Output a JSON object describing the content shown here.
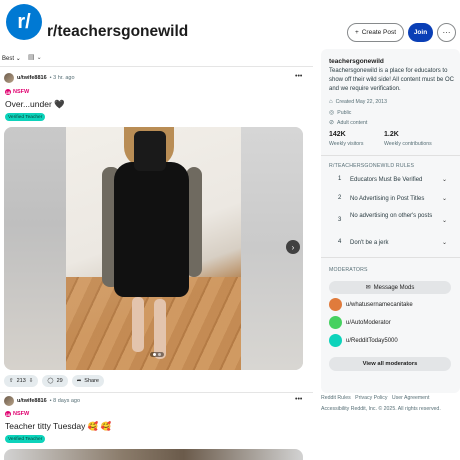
{
  "header": {
    "logo_text": "r/",
    "title": "r/teachersgonewild",
    "create_post_label": "Create Post",
    "join_label": "Join",
    "more_label": "···"
  },
  "sortbar": {
    "sort_label": "Best",
    "view_icon": "card-view-icon"
  },
  "posts": [
    {
      "user": "u/twife8816",
      "time": "• 3 hr. ago",
      "nsfw_label": "NSFW",
      "title": "Over...under 🖤",
      "flair": "Verified Teacher",
      "score": "213",
      "comments": "29",
      "share_label": "Share"
    },
    {
      "user": "u/twife8816",
      "time": "• 8 days ago",
      "nsfw_label": "NSFW",
      "title": "Teacher titty Tuesday 🥰 🥰",
      "flair": "Verified Teacher"
    }
  ],
  "sidebar": {
    "name": "teachersgonewild",
    "description": "Teachersgonewild is a place for educators to show off their wild side! All content must be OC and we require verification.",
    "created": "Created May 22, 2013",
    "visibility": "Public",
    "content_label": "Adult content",
    "visitors_count": "142K",
    "visitors_label": "Weekly visitors",
    "contributions_count": "1.2K",
    "contributions_label": "Weekly contributions",
    "rules_heading": "R/TEACHERSGONEWILD RULES",
    "rules": [
      {
        "n": "1",
        "text": "Educators Must Be Verified"
      },
      {
        "n": "2",
        "text": "No Advertising in Post Titles"
      },
      {
        "n": "3",
        "text": "No advertising on other's posts"
      },
      {
        "n": "4",
        "text": "Don't be a jerk"
      }
    ],
    "moderators_heading": "MODERATORS",
    "message_mods_label": "Message Mods",
    "moderators": [
      {
        "name": "u/whatusernamecanitake",
        "color": "#e07b3c"
      },
      {
        "name": "u/AutoModerator",
        "color": "#46d160"
      },
      {
        "name": "u/RedditToday5000",
        "color": "#0dd3bb"
      }
    ],
    "view_all_mods_label": "View all moderators"
  },
  "footer": {
    "links": [
      "Reddit Rules",
      "Privacy Policy",
      "User Agreement"
    ],
    "accessibility": "Accessibility",
    "copyright": "Reddit, Inc. © 2025. All rights reserved."
  }
}
